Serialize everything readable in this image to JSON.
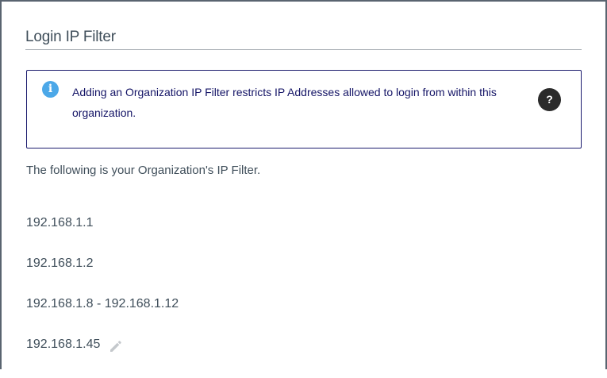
{
  "section": {
    "title": "Login IP Filter"
  },
  "info": {
    "icon": "info-icon",
    "icon_glyph": "i",
    "message": "Adding an Organization IP Filter restricts IP Addresses allowed to login from within this organization.",
    "help_icon": "help-icon",
    "help_glyph": "?",
    "accent_color": "#1c1c6e",
    "icon_color": "#4ca8e8"
  },
  "intro_text": "The following is your Organization's IP Filter.",
  "ip_filters": [
    {
      "value": "192.168.1.1"
    },
    {
      "value": "192.168.1.2"
    },
    {
      "value": "192.168.1.8 - 192.168.1.12"
    },
    {
      "value": "192.168.1.45",
      "icon": "pencil-icon"
    }
  ]
}
